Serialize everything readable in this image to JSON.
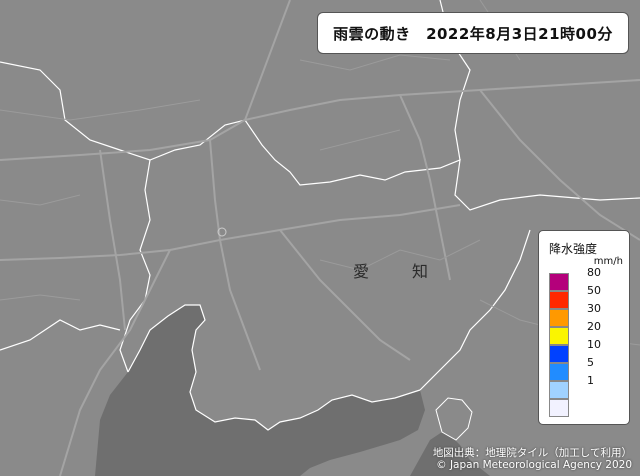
{
  "title": "雨雲の動き　2022年8月3日21時00分",
  "map": {
    "place_labels": [
      "愛",
      "知"
    ]
  },
  "legend": {
    "title": "降水強度",
    "unit": "mm/h",
    "items": [
      {
        "label": "80",
        "color": "#b4007b"
      },
      {
        "label": "50",
        "color": "#ff2800"
      },
      {
        "label": "30",
        "color": "#ff9900"
      },
      {
        "label": "20",
        "color": "#faf500"
      },
      {
        "label": "10",
        "color": "#0041ff"
      },
      {
        "label": "5",
        "color": "#218cff"
      },
      {
        "label": "1",
        "color": "#a0d2ff"
      },
      {
        "label": "",
        "color": "#f2f2ff"
      }
    ]
  },
  "footer": {
    "source": "地図出典：地理院タイル（加工して利用）",
    "copyright": "© Japan Meteorological Agency 2020"
  },
  "colors": {
    "land": "#8a8a8a",
    "sea": "#6e6e6e",
    "roads": "#a9a9a9",
    "borders": "#ffffff"
  }
}
